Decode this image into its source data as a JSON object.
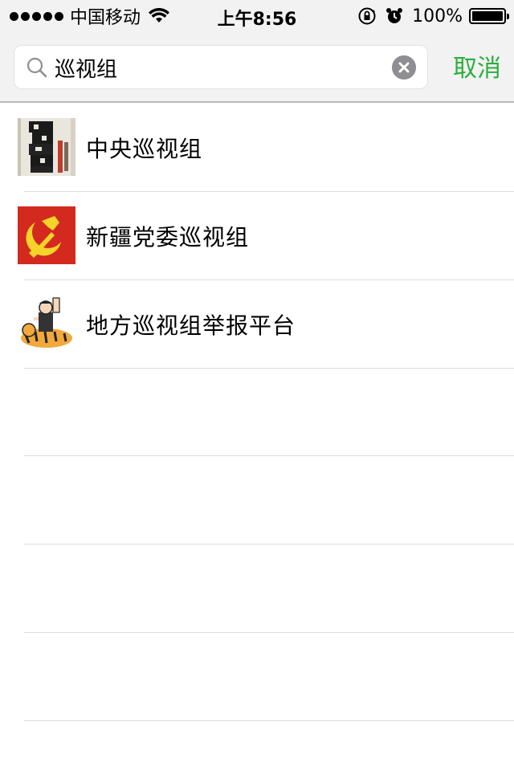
{
  "status_bar": {
    "carrier": "中国移动",
    "time": "上午8:56",
    "battery": "100%"
  },
  "search": {
    "query": "巡视组",
    "cancel_label": "取消"
  },
  "results": [
    {
      "title": "中央巡视组",
      "thumb_icon": "book-cover-thumbnail"
    },
    {
      "title": "新疆党委巡视组",
      "thumb_icon": "hammer-sickle-thumbnail"
    },
    {
      "title": "地方巡视组举报平台",
      "thumb_icon": "cartoon-tiger-thumbnail"
    }
  ],
  "colors": {
    "accent": "#2daf3c",
    "header_bg": "#f2f2f3",
    "divider": "#dcdcdc"
  }
}
